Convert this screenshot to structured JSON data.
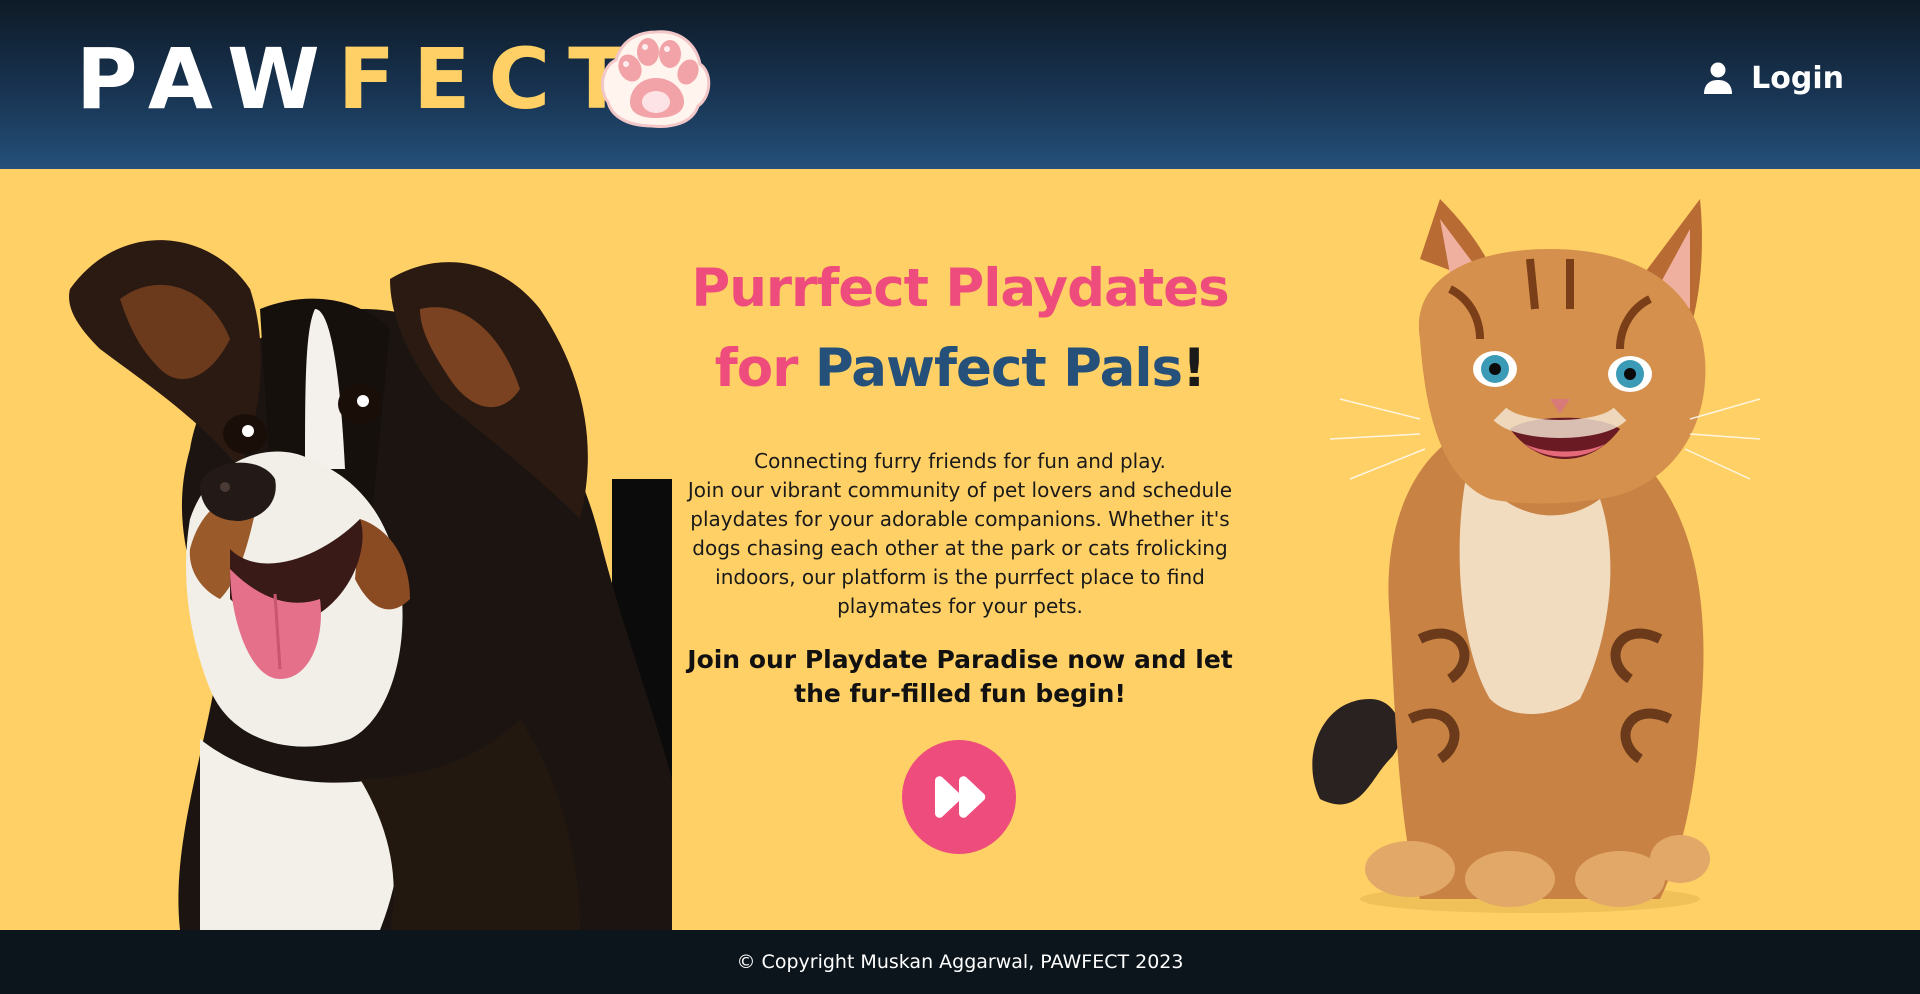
{
  "header": {
    "logo_part1": "PAW",
    "logo_part2": "FECT",
    "logo_icon": "paw-icon",
    "login_icon": "user-icon",
    "login_label": "Login"
  },
  "hero": {
    "title_line1": "Purrfect Playdates",
    "title_for": "for",
    "title_pals": "Pawfect Pals",
    "title_bang": "!",
    "description": [
      "Connecting furry friends for fun and play.",
      "Join our vibrant community of pet lovers and schedule playdates for your adorable companions. Whether it's dogs chasing each other at the park or cats frolicking indoors, our platform is the purrfect place to find playmates for your pets."
    ],
    "cta_text": "Join our Playdate Paradise now and let the fur-filled fun begin!",
    "play_icon": "fast-forward-icon"
  },
  "footer": {
    "copyright": "© Copyright Muskan Aggarwal, PAWFECT 2023"
  },
  "colors": {
    "brand_yellow": "#FFD065",
    "brand_pink": "#EE4C7C",
    "brand_blue": "#25507a",
    "header_dark": "#0e1a26",
    "footer_dark": "#0c151c"
  }
}
